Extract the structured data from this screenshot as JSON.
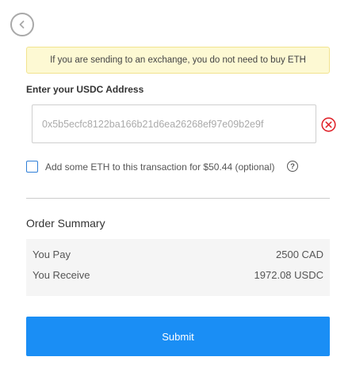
{
  "navigation": {
    "back_icon": "chevron-left-icon"
  },
  "notice": {
    "text": "If you are sending to an exchange, you do not need to buy ETH"
  },
  "address": {
    "label": "Enter your USDC Address",
    "placeholder": "0x5b5ecfc8122ba166b21d6ea26268ef97e09b2e9f",
    "value": "",
    "clear_icon": "close-circle-icon",
    "clear_icon_color": "#e0262d"
  },
  "eth_option": {
    "label": "Add some ETH to this transaction for $50.44 (optional)",
    "checked": false,
    "help_icon": "question-icon",
    "help_glyph": "?"
  },
  "order_summary": {
    "title": "Order Summary",
    "rows": [
      {
        "label": "You Pay",
        "value": "2500 CAD"
      },
      {
        "label": "You Receive",
        "value": "1972.08 USDC"
      }
    ]
  },
  "submit": {
    "label": "Submit",
    "color": "#1a8ef5"
  }
}
